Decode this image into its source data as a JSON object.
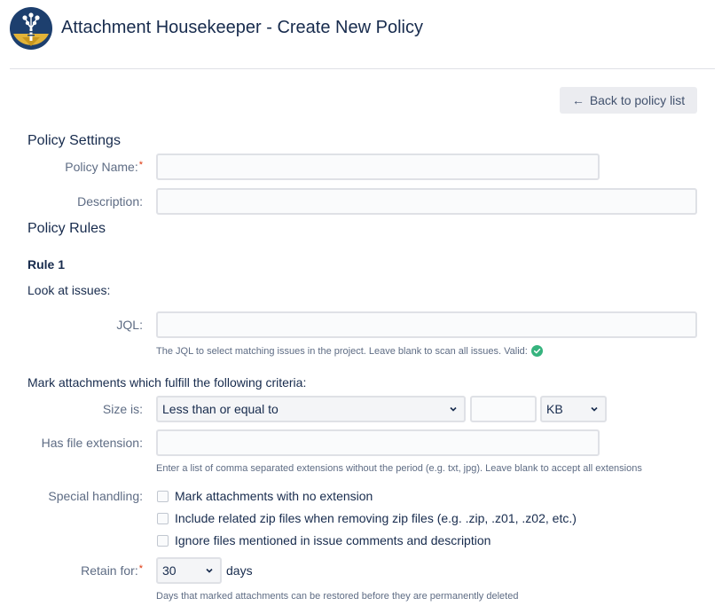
{
  "header": {
    "title": "Attachment Housekeeper - Create New Policy"
  },
  "toolbar": {
    "back_label": "Back to policy list"
  },
  "policy_settings": {
    "heading": "Policy Settings",
    "name_label": "Policy Name:",
    "name_value": "",
    "description_label": "Description:",
    "description_value": ""
  },
  "policy_rules": {
    "heading": "Policy Rules",
    "rule_title": "Rule 1",
    "look_at_issues": "Look at issues:",
    "jql_label": "JQL:",
    "jql_value": "",
    "jql_help": "The JQL to select matching issues in the project. Leave blank to scan all issues. Valid:",
    "criteria_text": "Mark attachments which fulfill the following criteria:",
    "size_label": "Size is:",
    "size_operator": "Less than or equal to",
    "size_value": "",
    "size_unit": "KB",
    "extension_label": "Has file extension:",
    "extension_value": "",
    "extension_help": "Enter a list of comma separated extensions without the period (e.g. txt, jpg). Leave blank to accept all extensions",
    "special_label": "Special handling:",
    "special_options": [
      "Mark attachments with no extension",
      "Include related zip files when removing zip files (e.g. .zip, .z01, .z02, etc.)",
      "Ignore files mentioned in issue comments and description"
    ],
    "retain_label": "Retain for:",
    "retain_value": "30",
    "retain_unit": "days",
    "retain_help": "Days that marked attachments can be restored before they are permanently deleted"
  },
  "colors": {
    "accent": "#0052cc",
    "valid": "#36b37e",
    "required": "#de350b"
  }
}
